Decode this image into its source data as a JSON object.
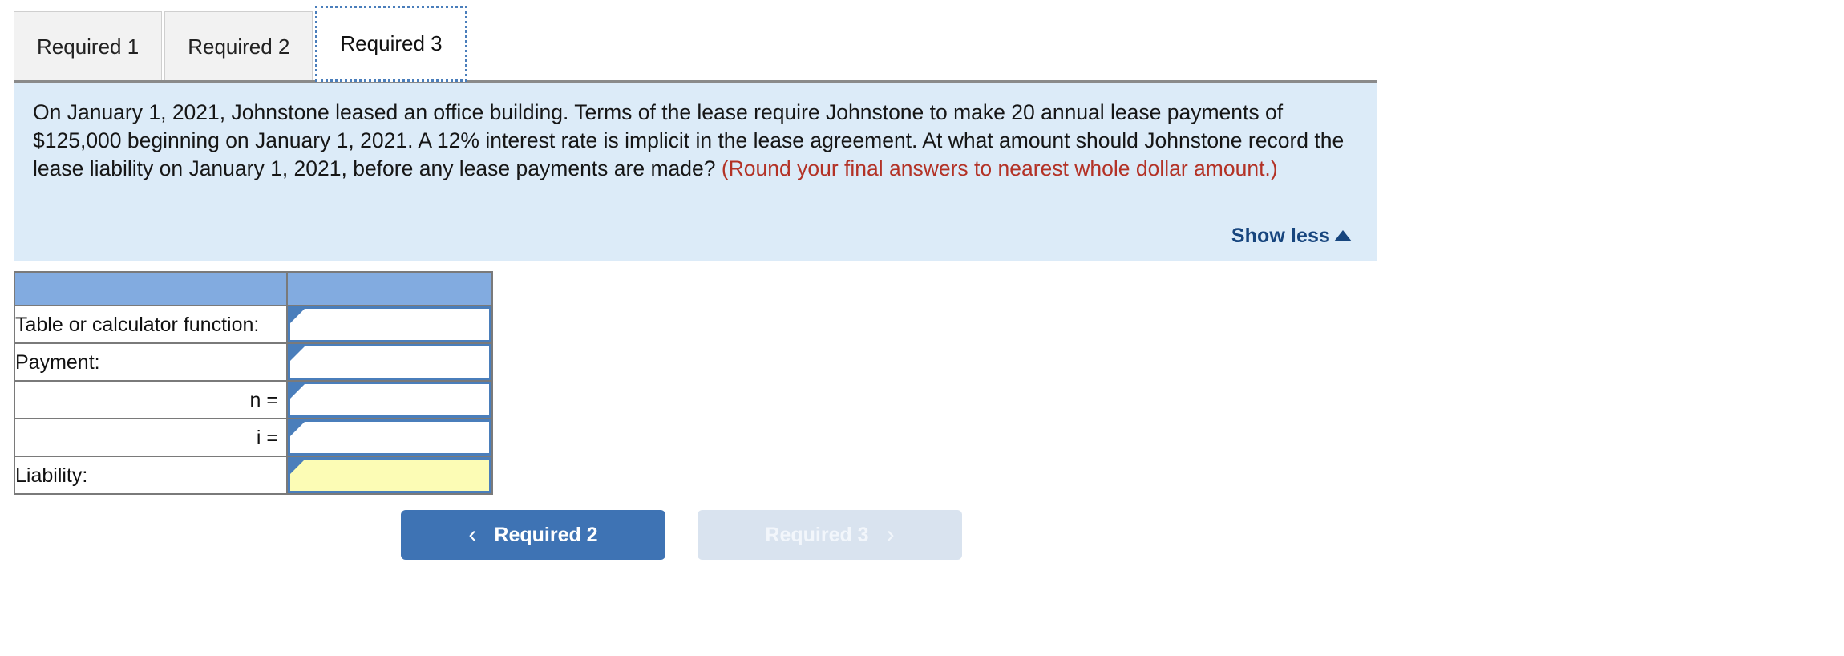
{
  "tabs": [
    {
      "label": "Required 1",
      "active": false
    },
    {
      "label": "Required 2",
      "active": false
    },
    {
      "label": "Required 3",
      "active": true
    }
  ],
  "question": {
    "body": "On January 1, 2021, Johnstone leased an office building. Terms of the lease require Johnstone to make 20 annual lease payments of $125,000 beginning on January 1, 2021. A 12% interest rate is implicit in the lease agreement. At what amount should Johnstone record the lease liability on January 1, 2021, before any lease payments are made? ",
    "note": "(Round your final answers to nearest whole dollar amount.)",
    "show_less_label": "Show less",
    "show_less_icon": "caret-up-icon"
  },
  "answer_table": {
    "header": {
      "left": "",
      "right": ""
    },
    "rows": [
      {
        "label": "Table or calculator function:",
        "align": "left",
        "value": "",
        "highlight": false
      },
      {
        "label": "Payment:",
        "align": "left",
        "value": "",
        "highlight": false
      },
      {
        "label": "n =",
        "align": "right",
        "value": "",
        "highlight": false
      },
      {
        "label": "i =",
        "align": "right",
        "value": "",
        "highlight": false
      },
      {
        "label": "Liability:",
        "align": "left",
        "value": "",
        "highlight": true
      }
    ]
  },
  "nav": {
    "prev": {
      "label": "Required 2",
      "icon": "chevron-left-icon",
      "glyph": "‹",
      "disabled": false
    },
    "next": {
      "label": "Required 3",
      "icon": "chevron-right-icon",
      "glyph": "›",
      "disabled": true
    }
  },
  "colors": {
    "panel_bg": "#dcebf8",
    "table_header": "#82abe0",
    "input_border": "#4a7ebb",
    "highlight_bg": "#fcfcb5",
    "accent_blue": "#3e73b4",
    "note_red": "#b33226",
    "link_blue": "#17457e",
    "disabled_bg": "#d9e3ef"
  }
}
